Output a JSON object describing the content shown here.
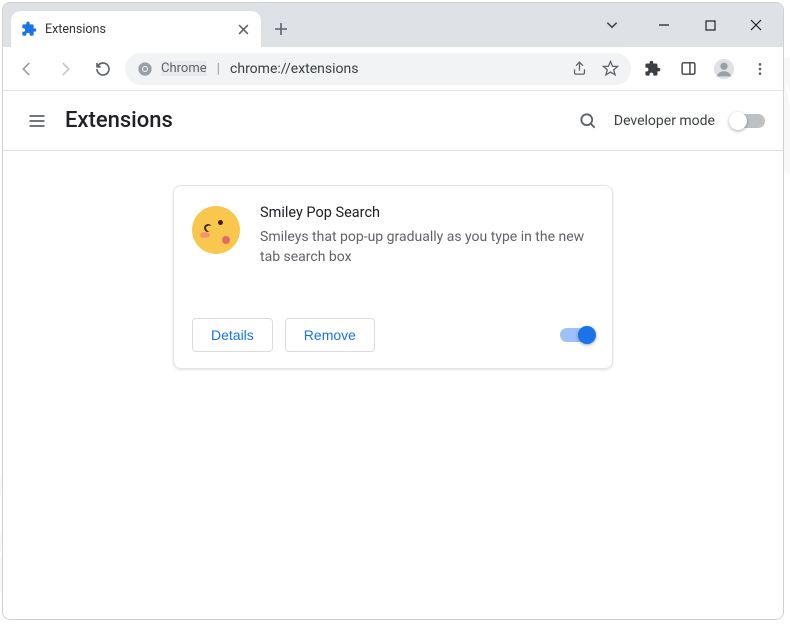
{
  "tab": {
    "title": "Extensions"
  },
  "omnibox": {
    "origin_label": "Chrome",
    "url_path": "chrome://extensions"
  },
  "page": {
    "title": "Extensions",
    "dev_mode_label": "Developer mode"
  },
  "extension": {
    "name": "Smiley Pop Search",
    "description": "Smileys that pop-up gradually as you type in the new tab search box",
    "details_label": "Details",
    "remove_label": "Remove"
  }
}
